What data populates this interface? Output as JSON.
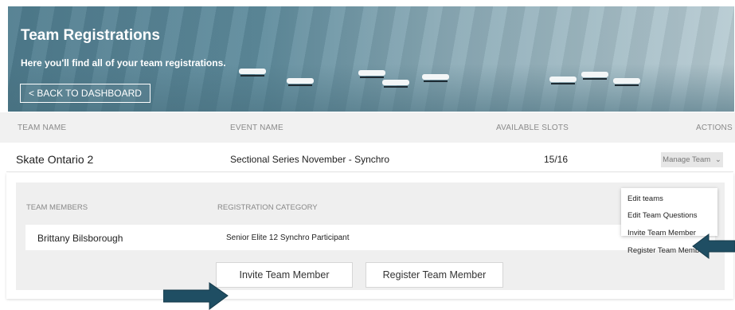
{
  "banner": {
    "title": "Team Registrations",
    "subtitle": "Here you'll find all of your team registrations.",
    "back_label": "< BACK TO DASHBOARD"
  },
  "table": {
    "headers": [
      "TEAM NAME",
      "EVENT NAME",
      "AVAILABLE SLOTS",
      "ACTIONS"
    ],
    "rows": [
      {
        "team_name": "Skate Ontario 2",
        "event_name": "Sectional Series November - Synchro",
        "slots": "15/16",
        "manage_label": "Manage Team"
      }
    ]
  },
  "members": {
    "headers": [
      "TEAM MEMBERS",
      "REGISTRATION CATEGORY"
    ],
    "rows": [
      {
        "name": "Brittany Bilsborough",
        "category": "Senior Elite 12 Synchro Participant"
      }
    ],
    "invite_label": "Invite Team Member",
    "register_label": "Register Team Member"
  },
  "dropdown": {
    "items": [
      "Edit teams",
      "Edit Team Questions",
      "Invite Team Member",
      "Register Team Member"
    ]
  },
  "colors": {
    "banner": "#5a8596",
    "arrow": "#1f4e63"
  }
}
